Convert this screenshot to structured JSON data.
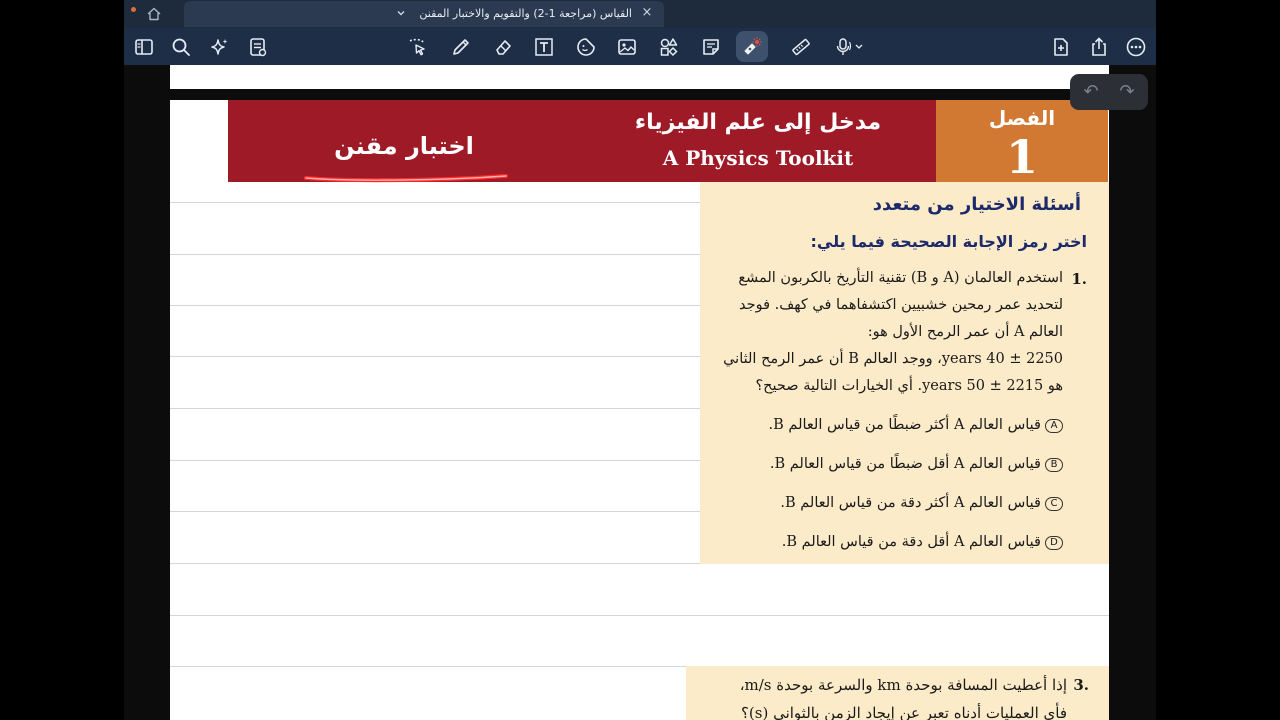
{
  "tab": {
    "title": "القياس (مراجعة 1-2) والتقويم والاختبار المقنن",
    "close_glyph": "×"
  },
  "toolbar": {
    "icons": [
      "sidebar-icon",
      "search-icon",
      "sparkle-icon",
      "document-list-icon",
      "lasso-icon",
      "pen-icon",
      "eraser-icon",
      "text-box-icon",
      "sticker-icon",
      "image-icon",
      "shapes-icon",
      "sticky-note-icon",
      "laser-pointer-icon",
      "ruler-icon",
      "microphone-icon",
      "add-page-icon",
      "share-icon",
      "more-icon"
    ],
    "accent": "#e94b3c"
  },
  "undo": {
    "undo_glyph": "↶",
    "redo_glyph": "↷"
  },
  "banner": {
    "chapter_label": "الفصل",
    "chapter_number": "1",
    "title_ar": "مدخل إلى علم الفيزياء",
    "title_en": "A Physics Toolkit",
    "tag": "اختبار مقنن",
    "color": "#9e1a26",
    "chapter_color": "#d17933"
  },
  "section": {
    "title": "أسئلة الاختيار من متعدد",
    "instruction": "اختر رمز الإجابة الصحيحة فيما يلي:"
  },
  "q1": {
    "number": "1.",
    "lines": [
      "استخدم العالمان (A و B) تقنية التأريخ بالكربون المشع",
      "لتحديد عمر رمحين خشبيين اكتشفاهما في كهف. فوجد",
      "العالم A أن عمر الرمح الأول هو:",
      "2250 ± 40 years، ووجد العالم B أن عمر الرمح الثاني",
      "هو 2215 ± 50 years. أي الخيارات التالية صحيح؟"
    ],
    "options": [
      {
        "letter": "A",
        "text": "قياس العالم A أكثر ضبطًا من قياس العالم B."
      },
      {
        "letter": "B",
        "text": "قياس العالم A أقل ضبطًا من قياس العالم B."
      },
      {
        "letter": "C",
        "text": "قياس العالم A أكثر دقة من قياس العالم B."
      },
      {
        "letter": "D",
        "text": "قياس العالم A أقل دقة من قياس العالم B."
      }
    ]
  },
  "q3": {
    "number": "3.",
    "lines": [
      "إذا أعطيت المسافة بوحدة km والسرعة بوحدة m/s،",
      "فأي العمليات أدناه تعبر عن إيجاد الزمن بالثواني (s)؟"
    ]
  }
}
